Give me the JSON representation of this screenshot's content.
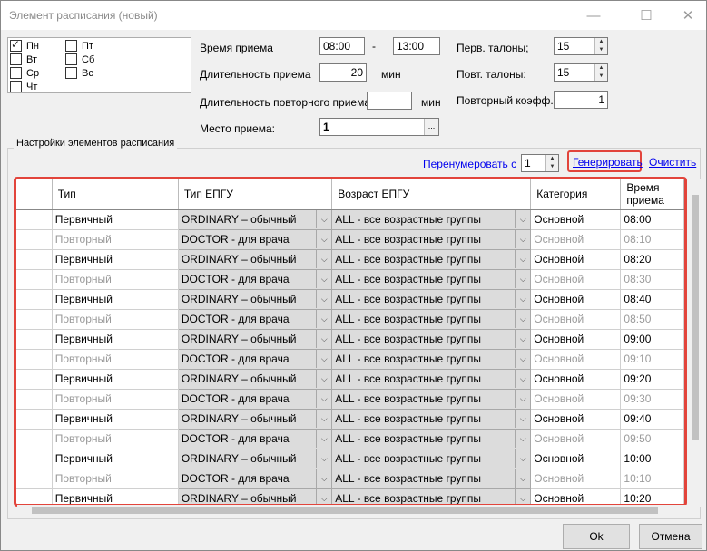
{
  "window": {
    "title": "Элемент расписания (новый)",
    "minimize": "—",
    "maximize": "☐",
    "close": "✕"
  },
  "days": [
    {
      "label": "Пн",
      "checked": true
    },
    {
      "label": "Вт",
      "checked": false
    },
    {
      "label": "Ср",
      "checked": false
    },
    {
      "label": "Чт",
      "checked": false
    },
    {
      "label": "Пт",
      "checked": false
    },
    {
      "label": "Сб",
      "checked": false
    },
    {
      "label": "Вс",
      "checked": false
    }
  ],
  "form": {
    "time_label": "Время приема",
    "time_from": "08:00",
    "time_dash": "-",
    "time_to": "13:00",
    "duration_label": "Длительность приема",
    "duration_value": "20",
    "duration_unit": "мин",
    "repeat_duration_label": "Длительность повторного приема",
    "repeat_duration_value": "",
    "repeat_duration_unit": "мин",
    "place_label": "Место приема:",
    "place_value": "1",
    "place_button": "...",
    "first_tickets_label": "Перв. талоны;",
    "first_tickets_value": "15",
    "repeat_tickets_label": "Повт. талоны:",
    "repeat_tickets_value": "15",
    "repeat_coef_label": "Повторный коэфф.",
    "repeat_coef_value": "1"
  },
  "settings": {
    "group_title": "Настройки  элементов  расписания",
    "renumber_link": "Перенумеровать  с",
    "renumber_value": "1",
    "generate_link": "Генерировать",
    "clear_link": "Очистить"
  },
  "table": {
    "headers": [
      "",
      "Тип",
      "Тип ЕПГУ",
      "Возраст ЕПГУ",
      "Категория",
      "Время приема"
    ],
    "rows": [
      {
        "type": "Первичный",
        "epgu": "ORDINARY – обычный",
        "age": "ALL - все возрастные группы",
        "cat": "Основной",
        "time": "08:00",
        "rep": false
      },
      {
        "type": "Повторный",
        "epgu": "DOCTOR - для врача",
        "age": "ALL - все возрастные группы",
        "cat": "Основной",
        "time": "08:10",
        "rep": true
      },
      {
        "type": "Первичный",
        "epgu": "ORDINARY – обычный",
        "age": "ALL - все возрастные группы",
        "cat": "Основной",
        "time": "08:20",
        "rep": false
      },
      {
        "type": "Повторный",
        "epgu": "DOCTOR - для врача",
        "age": "ALL - все возрастные группы",
        "cat": "Основной",
        "time": "08:30",
        "rep": true
      },
      {
        "type": "Первичный",
        "epgu": "ORDINARY – обычный",
        "age": "ALL - все возрастные группы",
        "cat": "Основной",
        "time": "08:40",
        "rep": false
      },
      {
        "type": "Повторный",
        "epgu": "DOCTOR - для врача",
        "age": "ALL - все возрастные группы",
        "cat": "Основной",
        "time": "08:50",
        "rep": true
      },
      {
        "type": "Первичный",
        "epgu": "ORDINARY – обычный",
        "age": "ALL - все возрастные группы",
        "cat": "Основной",
        "time": "09:00",
        "rep": false
      },
      {
        "type": "Повторный",
        "epgu": "DOCTOR - для врача",
        "age": "ALL - все возрастные группы",
        "cat": "Основной",
        "time": "09:10",
        "rep": true
      },
      {
        "type": "Первичный",
        "epgu": "ORDINARY – обычный",
        "age": "ALL - все возрастные группы",
        "cat": "Основной",
        "time": "09:20",
        "rep": false
      },
      {
        "type": "Повторный",
        "epgu": "DOCTOR - для врача",
        "age": "ALL - все возрастные группы",
        "cat": "Основной",
        "time": "09:30",
        "rep": true
      },
      {
        "type": "Первичный",
        "epgu": "ORDINARY – обычный",
        "age": "ALL - все возрастные группы",
        "cat": "Основной",
        "time": "09:40",
        "rep": false
      },
      {
        "type": "Повторный",
        "epgu": "DOCTOR - для врача",
        "age": "ALL - все возрастные группы",
        "cat": "Основной",
        "time": "09:50",
        "rep": true
      },
      {
        "type": "Первичный",
        "epgu": "ORDINARY – обычный",
        "age": "ALL - все возрастные группы",
        "cat": "Основной",
        "time": "10:00",
        "rep": false
      },
      {
        "type": "Повторный",
        "epgu": "DOCTOR - для врача",
        "age": "ALL - все возрастные группы",
        "cat": "Основной",
        "time": "10:10",
        "rep": true
      },
      {
        "type": "Первичный",
        "epgu": "ORDINARY – обычный",
        "age": "ALL - все возрастные группы",
        "cat": "Основной",
        "time": "10:20",
        "rep": false
      }
    ]
  },
  "buttons": {
    "ok": "Ok",
    "cancel": "Отмена"
  },
  "colors": {
    "highlight": "#e2443b",
    "link": "#0000ee"
  }
}
